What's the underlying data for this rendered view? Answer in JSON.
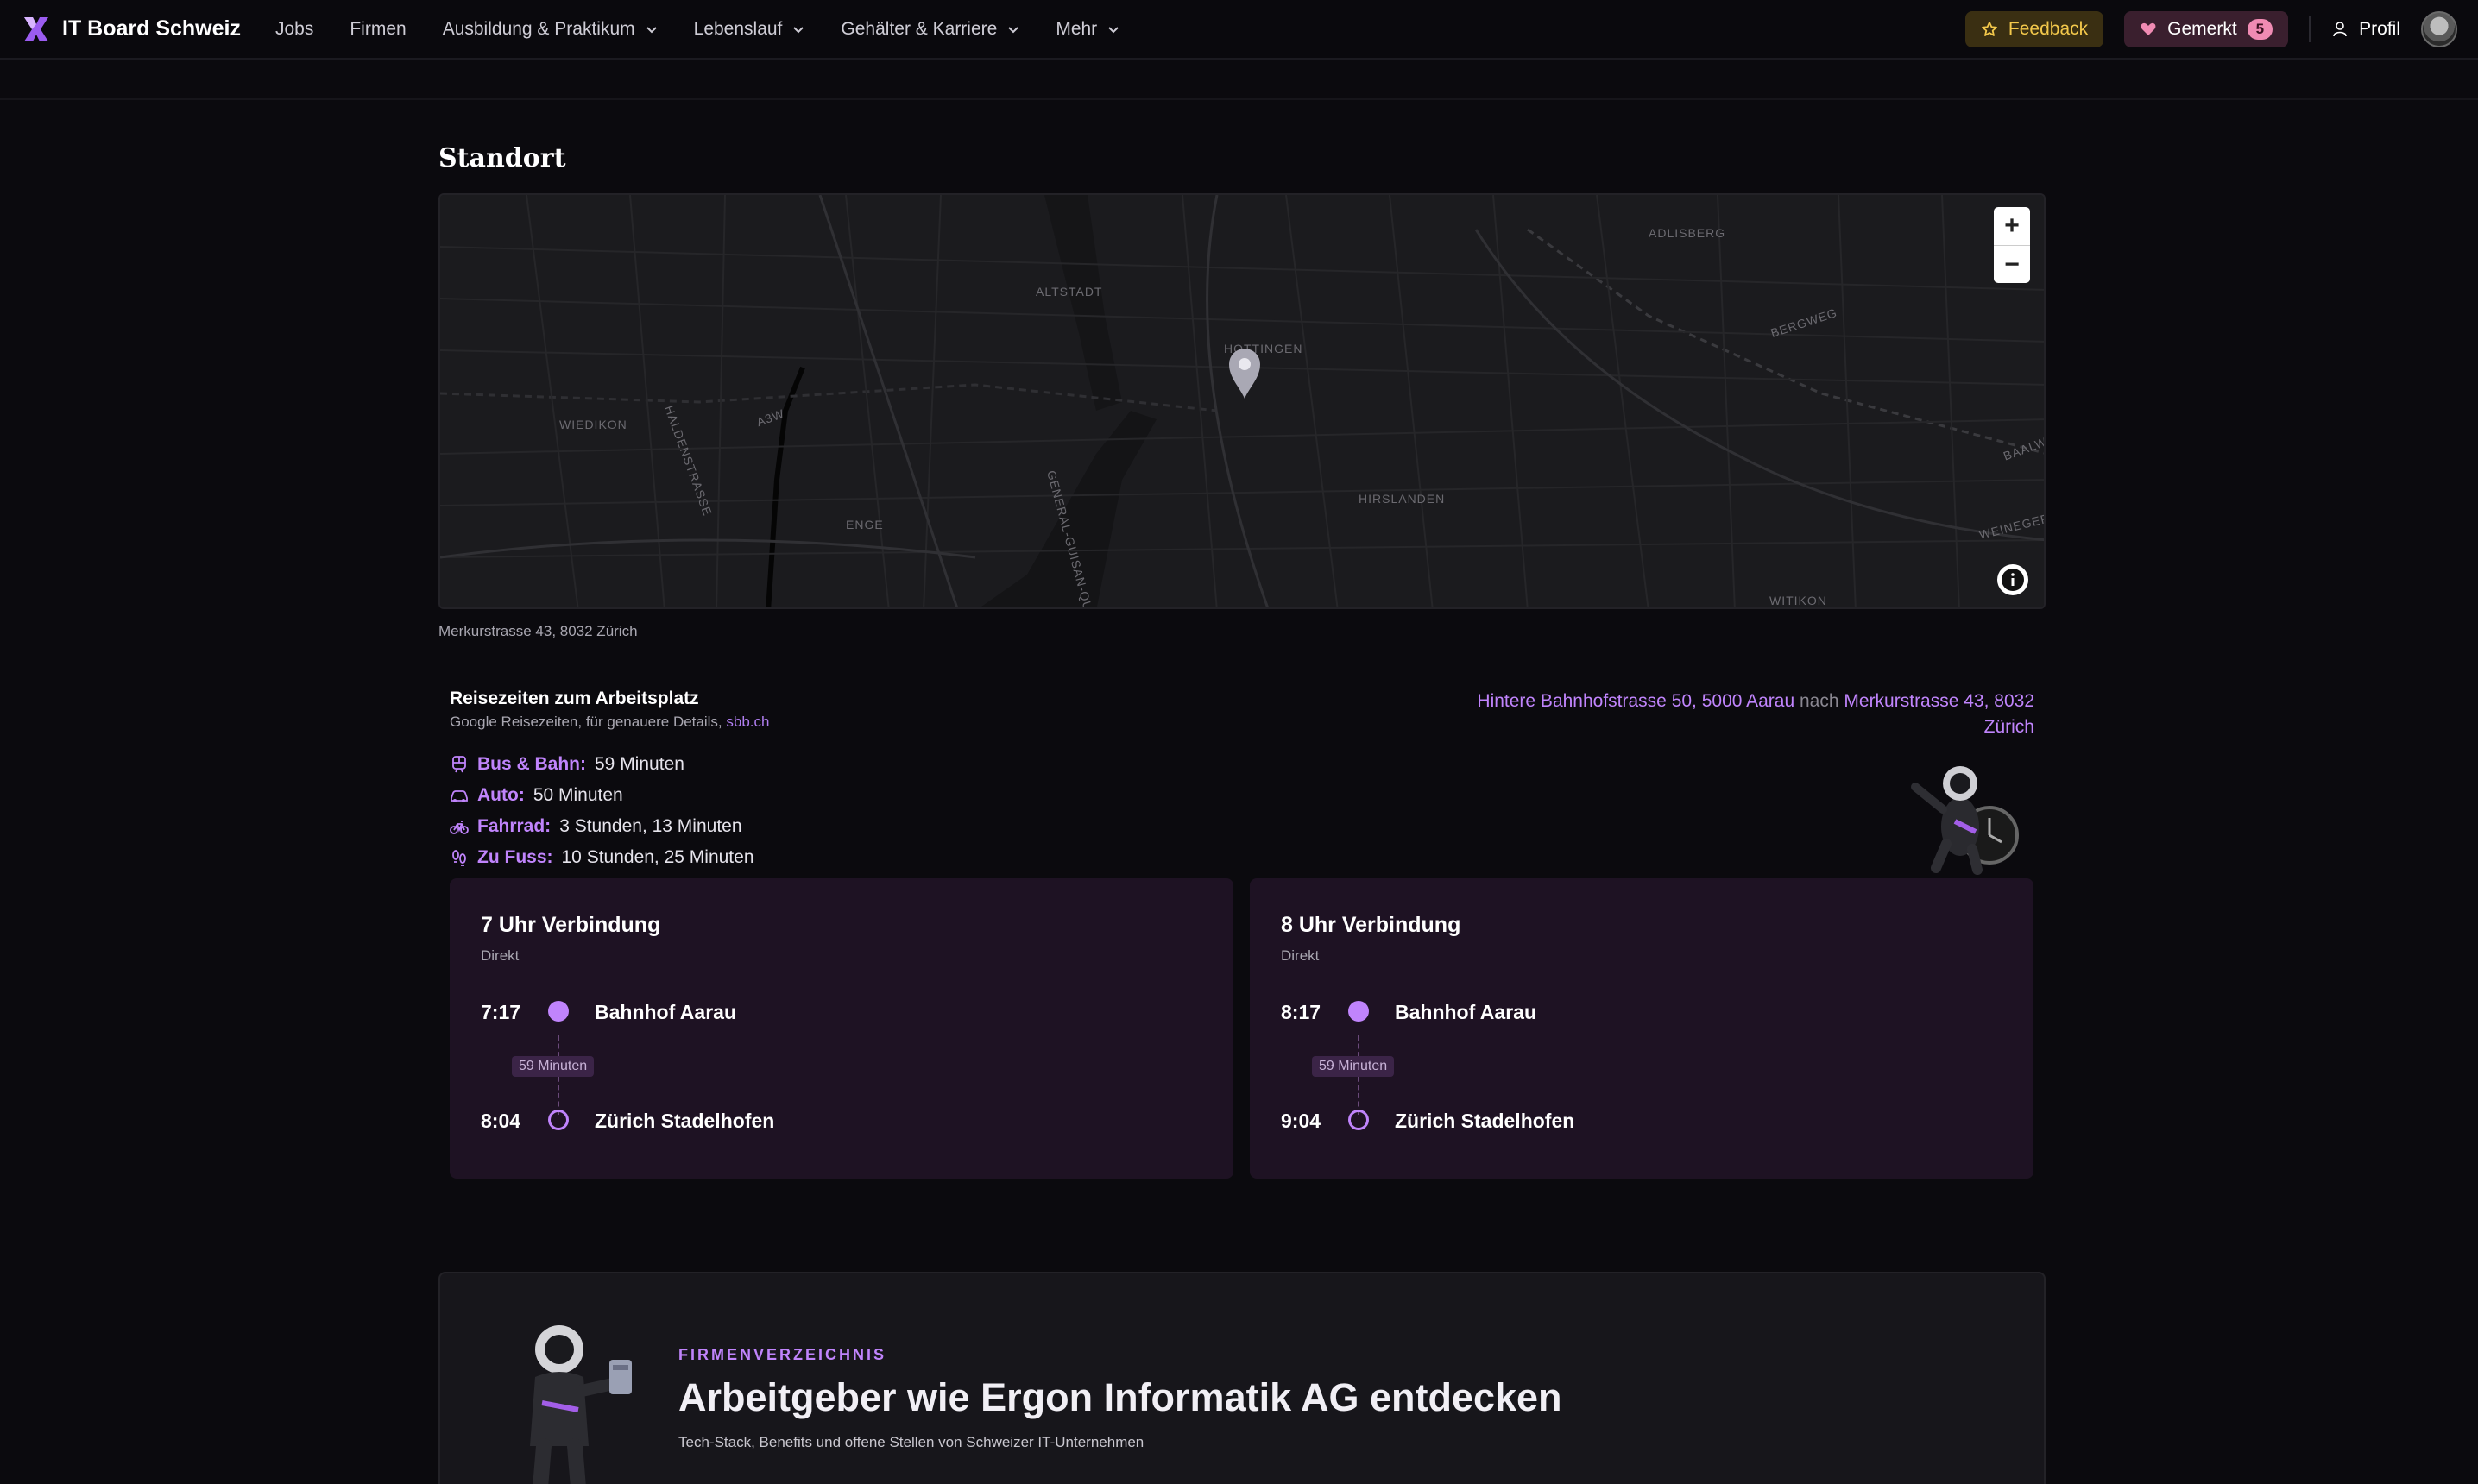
{
  "nav": {
    "brand": "IT Board Schweiz",
    "items": [
      {
        "label": "Jobs",
        "dropdown": false
      },
      {
        "label": "Firmen",
        "dropdown": false
      },
      {
        "label": "Ausbildung & Praktikum",
        "dropdown": true
      },
      {
        "label": "Lebenslauf",
        "dropdown": true
      },
      {
        "label": "Gehälter & Karriere",
        "dropdown": true
      },
      {
        "label": "Mehr",
        "dropdown": true
      }
    ],
    "feedback_label": "Feedback",
    "gemerkt_label": "Gemerkt",
    "gemerkt_count": "5",
    "profile_label": "Profil"
  },
  "location": {
    "title": "Standort",
    "address": "Merkurstrasse 43, 8032 Zürich",
    "map_labels": [
      "ADLISBERG",
      "ALTSTADT",
      "HOTTINGEN",
      "BERGWEG",
      "WIEDIKON",
      "HALDENSTRASSE",
      "ENGE",
      "HIRSLANDEN",
      "WITIKON",
      "BAALW",
      "WEINEGER",
      "A3W",
      "GENERAL-GUISAN-QUAI",
      "ADLISBERG"
    ],
    "zoom_in": "+",
    "zoom_out": "−"
  },
  "travel": {
    "title": "Reisezeiten zum Arbeitsplatz",
    "subtitle_prefix": "Google Reisezeiten, für genauere Details,",
    "subtitle_link": "sbb.ch",
    "route_from": "Hintere Bahnhofstrasse 50, 5000 Aarau",
    "route_sep": "nach",
    "route_to": "Merkurstrasse 43, 8032 Zürich",
    "modes": [
      {
        "icon": "train-icon",
        "label": "Bus & Bahn:",
        "value": "59 Minuten"
      },
      {
        "icon": "car-icon",
        "label": "Auto:",
        "value": "50 Minuten"
      },
      {
        "icon": "bicycle-icon",
        "label": "Fahrrad:",
        "value": "3 Stunden, 13 Minuten"
      },
      {
        "icon": "footprints-icon",
        "label": "Zu Fuss:",
        "value": "10 Stunden, 25 Minuten"
      }
    ]
  },
  "connections": [
    {
      "title": "7 Uhr Verbindung",
      "type": "Direkt",
      "dep_time": "7:17",
      "dep_stop": "Bahnhof Aarau",
      "duration": "59 Minuten",
      "arr_time": "8:04",
      "arr_stop": "Zürich Stadelhofen"
    },
    {
      "title": "8 Uhr Verbindung",
      "type": "Direkt",
      "dep_time": "8:17",
      "dep_stop": "Bahnhof Aarau",
      "duration": "59 Minuten",
      "arr_time": "9:04",
      "arr_stop": "Zürich Stadelhofen"
    }
  ],
  "directory": {
    "eyebrow": "FIRMENVERZEICHNIS",
    "title": "Arbeitgeber wie Ergon Informatik AG entdecken",
    "subtitle": "Tech-Stack, Benefits und offene Stellen von Schweizer IT-Unternehmen"
  },
  "colors": {
    "accent": "#c084fc",
    "background": "#0b0a0e",
    "card": "#1e1223",
    "feedback": "#f3c84b"
  }
}
